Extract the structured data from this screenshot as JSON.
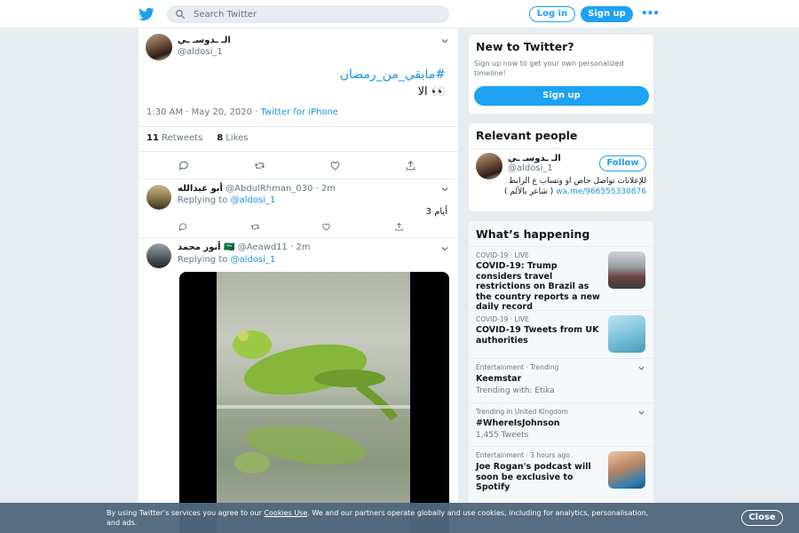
{
  "header": {
    "search_placeholder": "Search Twitter",
    "login_label": "Log in",
    "signup_label": "Sign up",
    "more_label": "•••"
  },
  "tweet": {
    "author_name": "الـ ـدوسـ ـي",
    "author_handle": "@aldosi_1",
    "hashtag": "#مابقي_من_رمضان",
    "body": "الا 👀",
    "timestamp": "1:30 AM · May 20, 2020",
    "source_separator": " · ",
    "source": "Twitter for iPhone",
    "retweets_count": "11",
    "retweets_label": "Retweets",
    "likes_count": "8",
    "likes_label": "Likes"
  },
  "replies": [
    {
      "name": "أبو عبدالله",
      "handle": "@AbdulRhman_030",
      "time": "· 2m",
      "replying_prefix": "Replying to",
      "replying_to": "@aldosi_1",
      "text": "3 أيام"
    },
    {
      "name": "أنور محمد 🇸🇦",
      "handle": "@Aeawd11",
      "time": "· 2m",
      "replying_prefix": "Replying to",
      "replying_to": "@aldosi_1"
    }
  ],
  "sidebar": {
    "new_to_twitter": {
      "title": "New to Twitter?",
      "text": "Sign up now to get your own personalized timeline!",
      "button": "Sign up"
    },
    "relevant_people": {
      "title": "Relevant people",
      "name": "الـ ـدوسـ ـي",
      "handle": "@aldosi_1",
      "follow_label": "Follow",
      "bio_text": "للإعلانات تواصل خاص او وتساب ع الرابط",
      "bio_link": "wa.me/966555330876",
      "bio_tail": "( شاعر بالألم )"
    },
    "happening": {
      "title": "What’s happening",
      "trends": [
        {
          "category": "COVID-19 · LIVE",
          "title": "COVID-19: Trump considers travel restrictions on Brazil as the country reports a new daily record",
          "subtitle": ""
        },
        {
          "category": "COVID-19 · LIVE",
          "title": "COVID-19 Tweets from UK authorities",
          "subtitle": ""
        },
        {
          "category": "Entertainment · Trending",
          "title": "Keemstar",
          "subtitle": "Trending with: Etika"
        },
        {
          "category": "Trending in United Kingdom",
          "title": "#WhereIsJohnson",
          "subtitle": "1,455 Tweets"
        },
        {
          "category": "Entertainment · 3 hours ago",
          "title": "Joe Rogan's podcast will soon be exclusive to Spotify",
          "subtitle": ""
        }
      ]
    }
  },
  "cookie": {
    "text_before": "By using Twitter’s services you agree to our ",
    "link": "Cookies Use",
    "text_after": ". We and our partners operate globally and use cookies, including for analytics, personalisation, and ads.",
    "close_label": "Close"
  },
  "colors": {
    "brand": "#1da1f2",
    "link": "#1b95e0",
    "background": "#e6ecf0",
    "cookie_bar": "#50677d"
  }
}
